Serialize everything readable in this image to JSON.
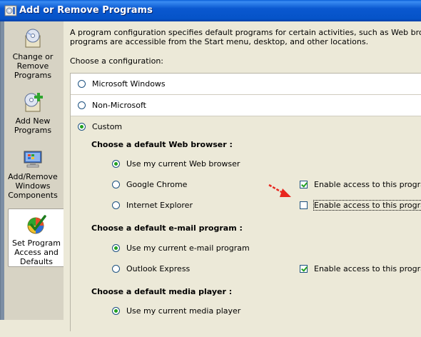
{
  "window": {
    "title": "Add or Remove Programs"
  },
  "sidebar": {
    "items": [
      {
        "label": "Change or Remove Programs",
        "icon": "cd-box-icon"
      },
      {
        "label": "Add New Programs",
        "icon": "cd-plus-icon"
      },
      {
        "label": "Add/Remove Windows Components",
        "icon": "windows-monitor-icon"
      },
      {
        "label": "Set Program Access and Defaults",
        "icon": "globe-check-icon",
        "selected": true
      }
    ]
  },
  "main": {
    "intro_line1": "A program configuration specifies default programs for certain activities, such as Web browsing or sen",
    "intro_line2": "programs are accessible from the Start menu, desktop, and other locations.",
    "choose_label": "Choose a configuration:",
    "configurations": [
      {
        "label": "Microsoft Windows",
        "selected": false
      },
      {
        "label": "Non-Microsoft",
        "selected": false
      },
      {
        "label": "Custom",
        "selected": true
      }
    ],
    "browser": {
      "heading": "Choose a default Web browser :",
      "options": [
        {
          "label": "Use my current Web browser",
          "selected": true
        },
        {
          "label": "Google Chrome",
          "selected": false,
          "access_label": "Enable access to this program",
          "access_checked": true
        },
        {
          "label": "Internet Explorer",
          "selected": false,
          "access_label": "Enable access to this program",
          "access_checked": false
        }
      ]
    },
    "email": {
      "heading": "Choose a default e-mail program :",
      "options": [
        {
          "label": "Use my current e-mail program",
          "selected": true
        },
        {
          "label": "Outlook Express",
          "selected": false,
          "access_label": "Enable access to this program",
          "access_checked": true
        }
      ]
    },
    "media": {
      "heading": "Choose a default media player :",
      "options": [
        {
          "label": "Use my current media player",
          "selected": true
        }
      ]
    }
  },
  "colors": {
    "titlebar": "#0553c8",
    "arrow": "#e8261e",
    "check": "#21a121"
  }
}
